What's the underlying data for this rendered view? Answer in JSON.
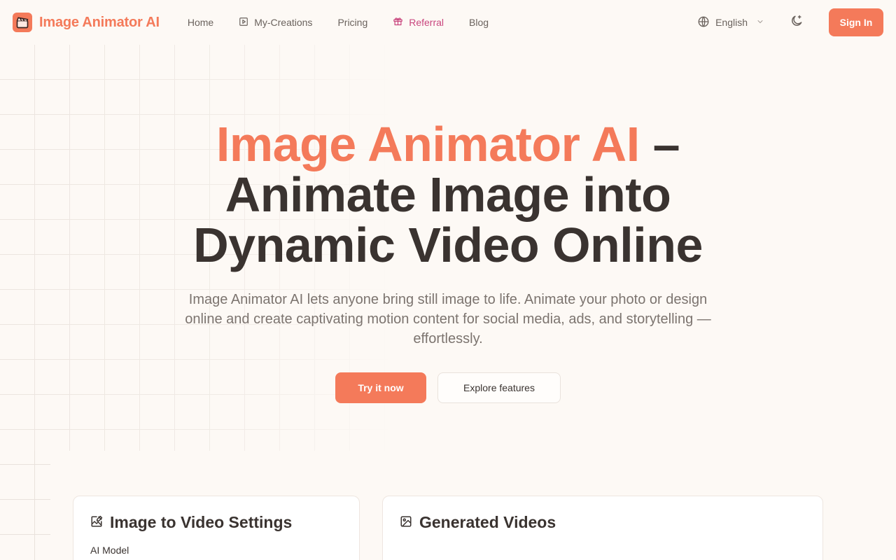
{
  "header": {
    "logo_text": "Image Animator AI",
    "nav": [
      {
        "label": "Home"
      },
      {
        "label": "My-Creations"
      },
      {
        "label": "Pricing"
      },
      {
        "label": "Referral"
      },
      {
        "label": "Blog"
      }
    ],
    "language": "English",
    "sign_in": "Sign In"
  },
  "hero": {
    "title_accent": "Image Animator AI",
    "title_rest_1": " –",
    "title_line_2": "Animate Image into",
    "title_line_3": "Dynamic Video Online",
    "subtitle": "Image Animator AI lets anyone bring still image to life. Animate your photo or design online and create captivating motion content for social media, ads, and storytelling — effortlessly.",
    "primary_cta": "Try it now",
    "secondary_cta": "Explore features"
  },
  "settings_card": {
    "title": "Image to Video Settings",
    "label_model": "AI Model"
  },
  "videos_card": {
    "title": "Generated Videos"
  },
  "colors": {
    "accent": "#f47a5a",
    "referral": "#c9467e",
    "background": "#fdf9f5"
  },
  "icons": {
    "logo": "clapperboard-icon",
    "my_creations": "play-square-icon",
    "referral": "gift-icon",
    "language": "globe-icon",
    "language_caret": "chevron-down-icon",
    "theme": "moon-icon",
    "settings_card": "image-edit-icon",
    "videos_card": "image-icon"
  }
}
